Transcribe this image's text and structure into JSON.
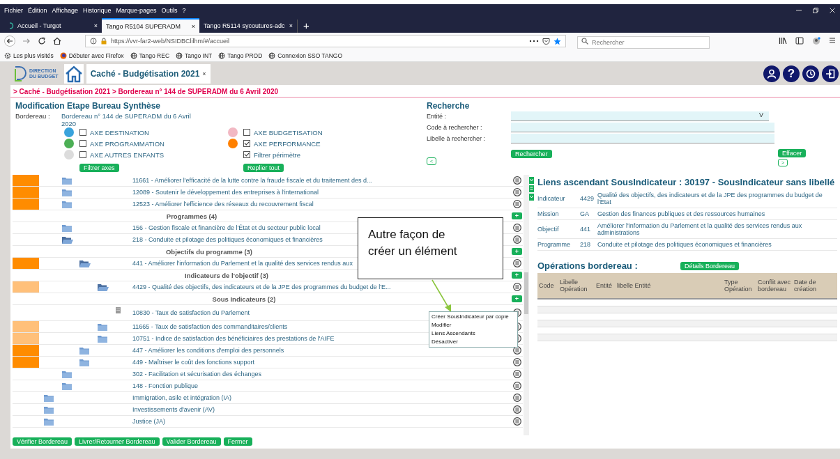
{
  "browser": {
    "menu": [
      "Fichier",
      "Édition",
      "Affichage",
      "Historique",
      "Marque-pages",
      "Outils",
      "?"
    ],
    "tabs": [
      {
        "title": "Accueil - Turgot",
        "selected": false,
        "close": "×"
      },
      {
        "title": "Tango R5104 SUPERADM",
        "selected": true,
        "close": "×"
      },
      {
        "title": "Tango R5114 sycoutures-adc",
        "selected": false,
        "close": "×"
      }
    ],
    "new_tab": "+",
    "url": "https://vvr-far2-web/NSIDBClilhm/#/accueil",
    "search": {
      "placeholder": "Rechercher"
    },
    "bookmarks": [
      {
        "label": "Les plus visités",
        "kind": "gear"
      },
      {
        "label": "Débuter avec Firefox",
        "kind": "firefox"
      },
      {
        "label": "Tango REC",
        "kind": "globe"
      },
      {
        "label": "Tango INT",
        "kind": "globe"
      },
      {
        "label": "Tango PROD",
        "kind": "globe"
      },
      {
        "label": "Connexion SSO TANGO",
        "kind": "globe"
      }
    ]
  },
  "app": {
    "logo": [
      "DIRECTION",
      "DU BUDGET"
    ],
    "tab": {
      "title": "Caché - Budgétisation 2021",
      "close": "×"
    },
    "header_buttons": [
      {
        "kind": "user"
      },
      {
        "kind": "help",
        "label": "?"
      },
      {
        "kind": "history"
      },
      {
        "kind": "exit"
      }
    ],
    "breadcrumb": "> Caché - Budgétisation 2021 > Bordereau n° 144 de SUPERADM du 6 Avril 2020"
  },
  "form": {
    "title": "Modification Etape Bureau Synthèse",
    "bordereau_label": "Bordereau :",
    "bordereau_value": "Bordereau n° 144 de SUPERADM du 6 Avril 2020",
    "axes": [
      {
        "label": "AXE DESTINATION",
        "color": "#3aa3dc",
        "checked": false
      },
      {
        "label": "AXE BUDGETISATION",
        "color": "#f2b8c3",
        "checked": false
      },
      {
        "label": "AXE PROGRAMMATION",
        "color": "#4caf55",
        "checked": false
      },
      {
        "label": "AXE PERFORMANCE",
        "color": "#ff8000",
        "checked": true
      },
      {
        "label": "AXE AUTRES ENFANTS",
        "color": "#dcdcdc",
        "checked": false
      }
    ],
    "filter": {
      "label": "Filtrer périmètre",
      "checked": true
    },
    "filter_button": "Filtrer axes",
    "collapse_button": "Replier tout"
  },
  "search_panel": {
    "title": "Recherche",
    "fields": [
      {
        "label": "Entité :",
        "kind": "select",
        "caret": "V"
      },
      {
        "label": "Code à rechercher :",
        "kind": "text"
      },
      {
        "label": "Libelle à rechercher :",
        "kind": "text"
      }
    ],
    "search_button": "Rechercher",
    "clear_button": "Effacer",
    "prev": "<",
    "next": ">"
  },
  "tree": [
    {
      "kind": "scrolled_parent",
      "children": [
        {
          "kind": "node",
          "label": "11661 - Améliorer l'efficacité de la lutte contre la fraude fiscale et du traitement des d...",
          "color": "#ff8c00"
        },
        {
          "kind": "node",
          "label": "12089 - Soutenir le développement des entreprises à l'international",
          "color": "#ff8c00"
        },
        {
          "kind": "node",
          "label": "12523 - Améliorer l'efficience des réseaux du recouvrement fiscal",
          "color": "#ff8c00"
        },
        {
          "kind": "header",
          "label": "Programmes (4)",
          "add": "+"
        },
        {
          "kind": "node",
          "label": "156 - Gestion fiscale et financière de l'État et du secteur public local"
        },
        {
          "kind": "node",
          "label": "218 - Conduite et pilotage des politiques économiques et financières",
          "children": [
            {
              "kind": "header",
              "label": "Objectifs du programme (3)",
              "add": "+"
            },
            {
              "kind": "node",
              "label": "441 - Améliorer l'information du Parlement et la qualité des services rendus aux",
              "color": "#ff8c00",
              "children": [
                {
                  "kind": "header",
                  "label": "Indicateurs de l'objectif (3)",
                  "add": "+"
                },
                {
                  "kind": "node",
                  "label": "4429 - Qualité des objectifs, des indicateurs et de la JPE des programmes du budget de l'E...",
                  "color": "#ffc07a",
                  "children": [
                    {
                      "kind": "header",
                      "label": "Sous Indicateurs (2)",
                      "add": "+"
                    },
                    {
                      "kind": "leaf",
                      "label": "10830 - Taux de satisfaction du Parlement"
                    }
                  ]
                },
                {
                  "kind": "node",
                  "label": "11665 - Taux de satisfaction des commanditaires/clients",
                  "color": "#ffc07a"
                },
                {
                  "kind": "node",
                  "label": "10751 - Indice de satisfaction des bénéficiaires des prestations de l'AIFE",
                  "color": "#ffc07a"
                }
              ]
            },
            {
              "kind": "node",
              "label": "447 - Améliorer les conditions d'emploi des personnels",
              "color": "#ff8c00"
            },
            {
              "kind": "node",
              "label": "449 - Maîtriser le coût des fonctions support",
              "color": "#ff8c00"
            }
          ]
        },
        {
          "kind": "node",
          "label": "302 - Facilitation et sécurisation des échanges"
        },
        {
          "kind": "node",
          "label": "148 - Fonction publique"
        }
      ]
    },
    {
      "kind": "node",
      "label": "Immigration, asile et intégration (IA)"
    },
    {
      "kind": "node",
      "label": "Investissements d'avenir (AV)"
    },
    {
      "kind": "node",
      "label": "Justice (JA)"
    }
  ],
  "context_menu": [
    "Créer SousIndicateur par copie",
    "Modifier",
    "Liens Ascendants",
    "Désactiver"
  ],
  "callout": "Autre façon de créer un élément",
  "links": {
    "title": "Liens ascendant SousIndicateur : 30197 - SousIndicateur sans libellé",
    "rows": [
      {
        "type": "Indicateur",
        "code": "4429",
        "label": "Qualité des objectifs, des indicateurs et de la JPE des programmes du budget de l'Etat"
      },
      {
        "type": "Mission",
        "code": "GA",
        "label": "Gestion des finances publiques et des ressources humaines"
      },
      {
        "type": "Objectif",
        "code": "441",
        "label": "Améliorer l'information du Parlement et la qualité des services rendus aux administrations"
      },
      {
        "type": "Programme",
        "code": "218",
        "label": "Conduite et pilotage des politiques économiques et financières"
      }
    ]
  },
  "operations": {
    "title": "Opérations bordereau :",
    "details_button": "Détails Bordereau",
    "columns": [
      "Code",
      "Libelle Opération",
      "Entité",
      "libelle Entité",
      "Type Opération",
      "Conflit avec bordereau",
      "Date de création"
    ]
  },
  "footer_buttons": [
    "Vérifier Bordereau",
    "Livrer/Retourner Bordereau",
    "Valider Bordereau",
    "Fermer"
  ]
}
